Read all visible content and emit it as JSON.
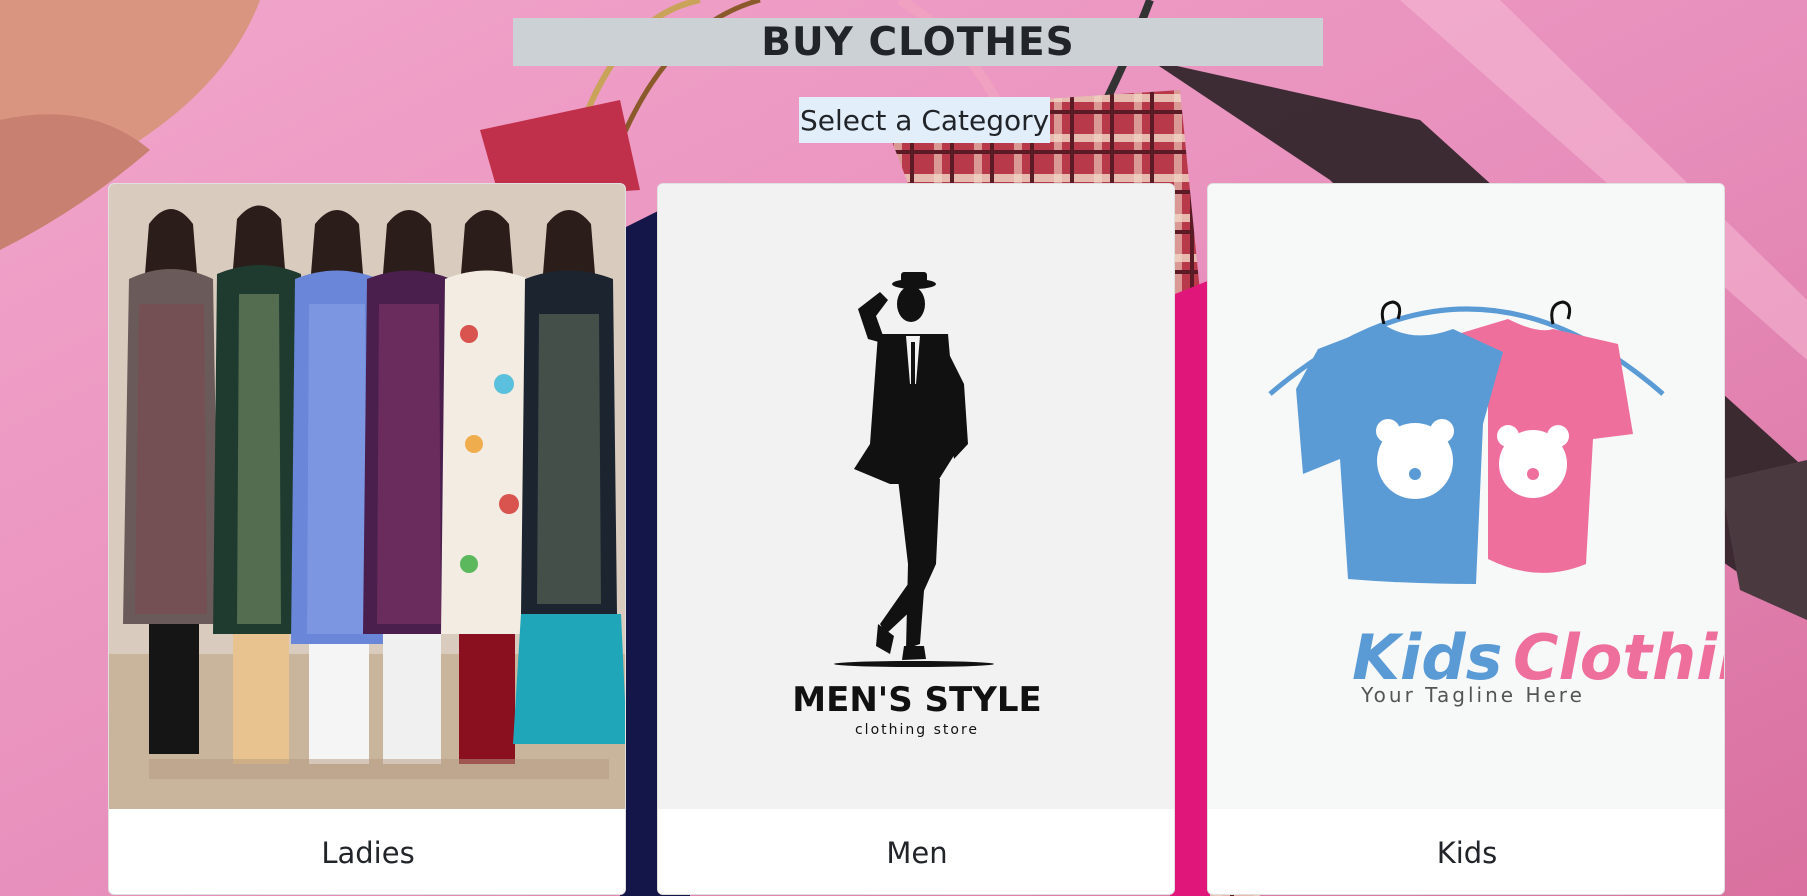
{
  "page": {
    "title": "BUY CLOTHES",
    "subtitle": "Select a Category"
  },
  "categories": [
    {
      "label": "Ladies",
      "image": "ladies-kurti-models-photo"
    },
    {
      "label": "Men",
      "image": "mens-style-logo",
      "logo_text": "MEN'S STYLE",
      "logo_subtext": "clothing store"
    },
    {
      "label": "Kids",
      "image": "kids-clothing-logo",
      "logo_text_kids": "Kids",
      "logo_text_clothing": "Clothing",
      "logo_tagline": "Your Tagline Here"
    }
  ],
  "colors": {
    "title_bg": "#ccd1d6",
    "subtitle_bg": "#e3eefb",
    "page_bg_pink": "#e98bbb",
    "kids_blue": "#5b9bd5",
    "kids_pink": "#ee6f9b"
  }
}
